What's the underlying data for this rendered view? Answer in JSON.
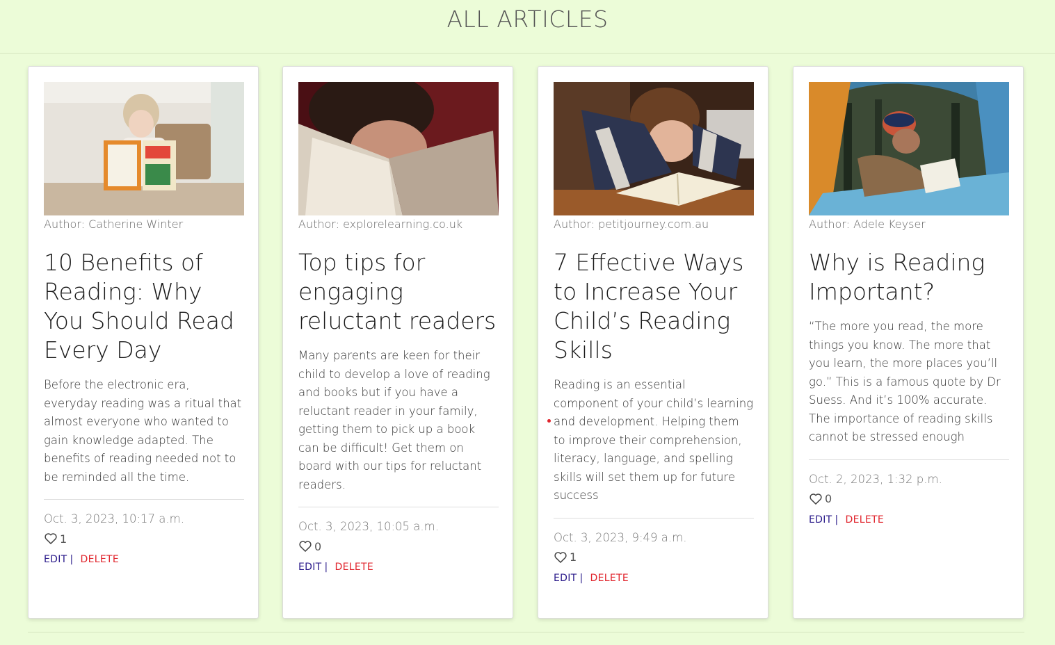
{
  "page": {
    "title": "ALL ARTICLES"
  },
  "colors": {
    "background": "#ecfcd8",
    "edit": "#2a1a8a",
    "delete": "#e0242c"
  },
  "articles": [
    {
      "author": "Author: Catherine Winter",
      "title": "10 Benefits of Reading: Why You Should Read Every Day",
      "excerpt": "Before the electronic era, everyday reading was a ritual that almost everyone who wanted to gain knowledge adapted. The benefits of reading needed not to be reminded all the time.",
      "date": "Oct. 3, 2023, 10:17 a.m.",
      "likes": "1",
      "edit_label": "EDIT",
      "separator": "|",
      "delete_label": "DELETE",
      "image_icon": "child-reading-book-photo"
    },
    {
      "author": "Author: explorelearning.co.uk",
      "title": "Top tips for engaging reluctant readers",
      "excerpt": "Many parents are keen for their child to develop a love of reading and books but if you have a reluctant reader in your family, getting them to pick up a book can be difficult! Get them on board with our tips for reluctant readers.",
      "date": "Oct. 3, 2023, 10:05 a.m.",
      "likes": "0",
      "edit_label": "EDIT",
      "separator": "|",
      "delete_label": "DELETE",
      "image_icon": "girl-behind-book-photo"
    },
    {
      "author": "Author: petitjourney.com.au",
      "title": "7 Effective Ways to Increase Your Child’s Reading Skills",
      "excerpt": "Reading is an essential component of your child’s learning and development. Helping them to improve their comprehension, literacy, language, and spelling skills will set them up for future success",
      "date": "Oct. 3, 2023, 9:49 a.m.",
      "likes": "1",
      "edit_label": "EDIT",
      "separator": "|",
      "delete_label": "DELETE",
      "image_icon": "boy-reading-book-photo"
    },
    {
      "author": "Author: Adele Keyser",
      "title": "Why is Reading Important?",
      "excerpt": "“The more you read, the more things you know. The more that you learn, the more places you’ll go.” This is a famous quote by Dr Suess. And it’s 100% accurate. The importance of reading skills cannot be stressed enough",
      "date": "Oct. 2, 2023, 1:32 p.m.",
      "likes": "0",
      "edit_label": "EDIT",
      "separator": "|",
      "delete_label": "DELETE",
      "image_icon": "child-reading-in-tent-photo"
    }
  ]
}
